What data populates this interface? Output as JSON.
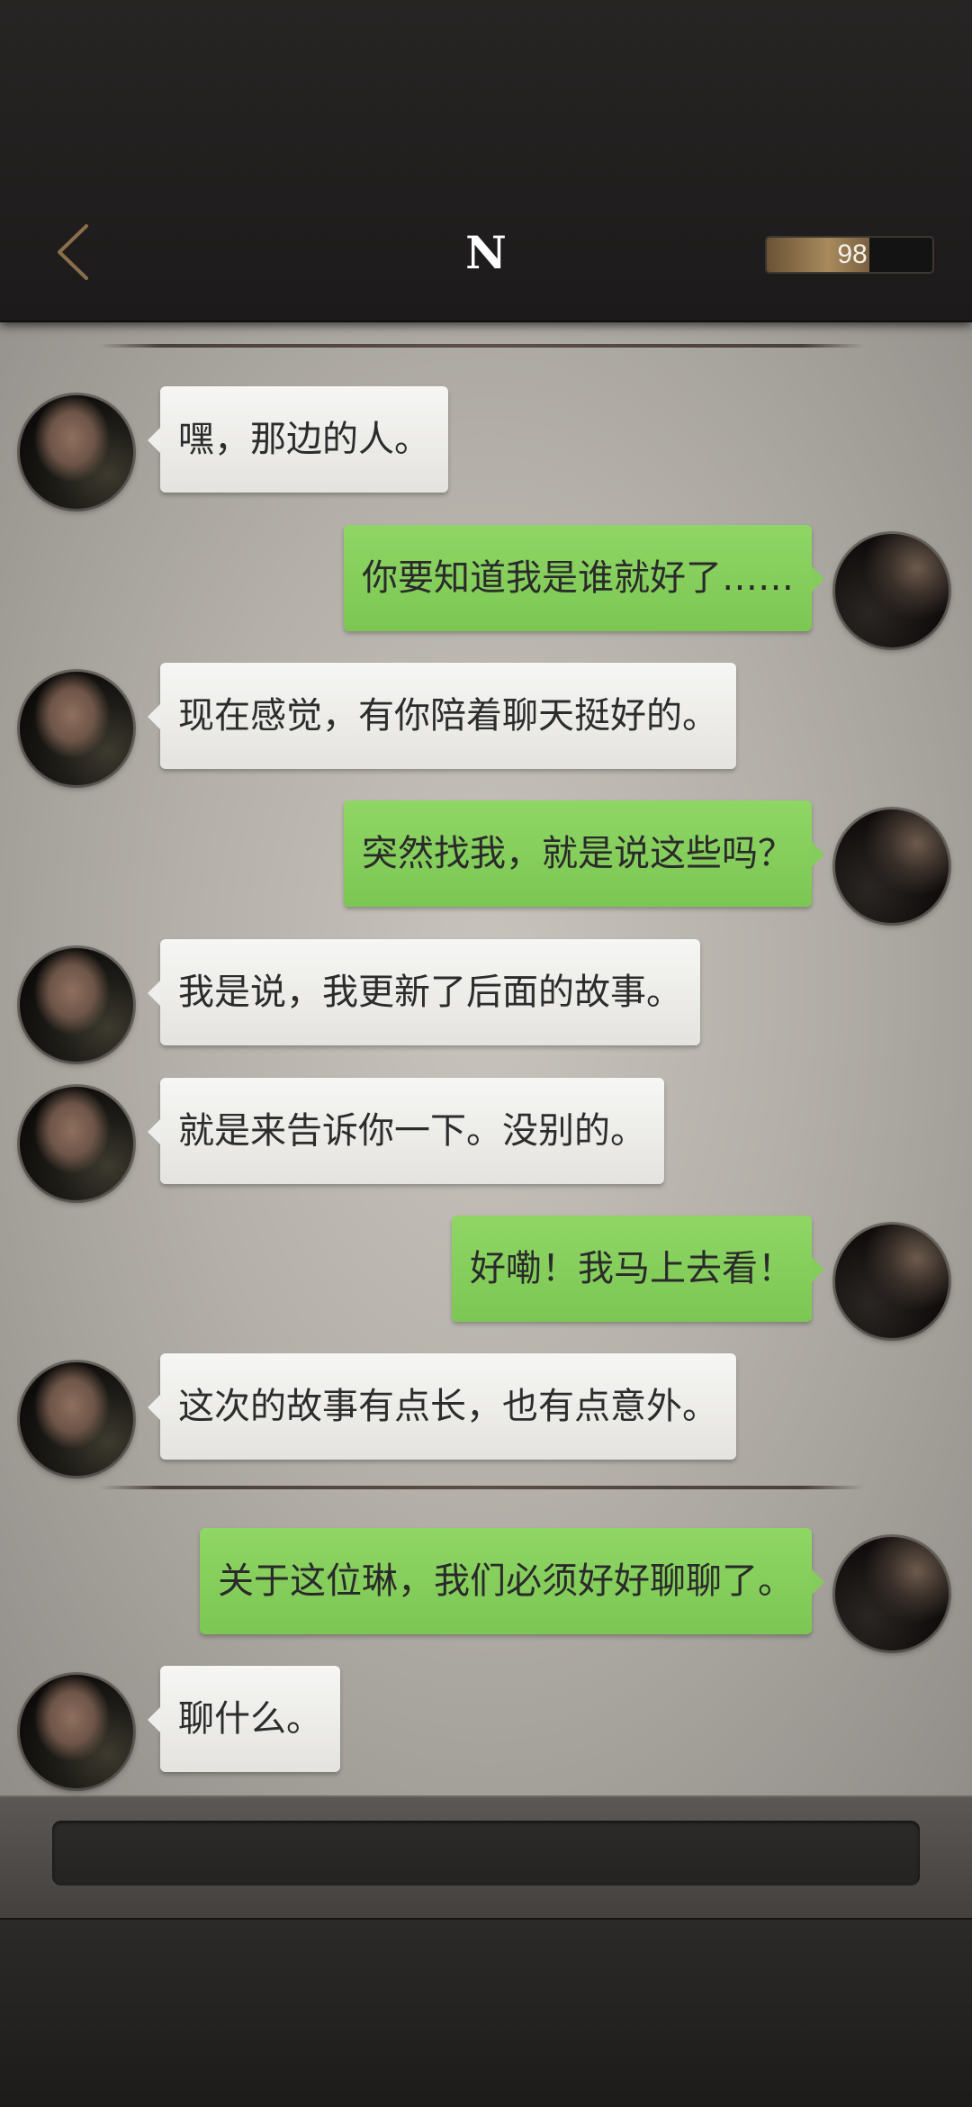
{
  "header": {
    "back_icon": "chevron-left-icon",
    "title": "N",
    "energy": {
      "value": "98",
      "fill_fraction": 0.62,
      "fill_color": "#a88a5c"
    }
  },
  "colors": {
    "incoming_bubble": "#eeeeec",
    "outgoing_bubble": "#84cc5b",
    "chat_background": "#b4b0a9"
  },
  "messages": [
    {
      "sender": "N",
      "text": "嘿，那边的人。"
    },
    {
      "sender": "me",
      "text": "你要知道我是谁就好了……"
    },
    {
      "sender": "N",
      "text": "现在感觉，有你陪着聊天挺好的。"
    },
    {
      "sender": "me",
      "text": "突然找我，就是说这些吗？"
    },
    {
      "sender": "N",
      "text": "我是说，我更新了后面的故事。"
    },
    {
      "sender": "N",
      "text": "就是来告诉你一下。没别的。"
    },
    {
      "sender": "me",
      "text": "好嘞！我马上去看！"
    },
    {
      "sender": "N",
      "text": "这次的故事有点长，也有点意外。"
    },
    {
      "sender": "me",
      "text": "关于这位琳，我们必须好好聊聊了。"
    },
    {
      "sender": "N",
      "text": "聊什么。"
    }
  ],
  "input": {
    "value": "",
    "placeholder": ""
  }
}
